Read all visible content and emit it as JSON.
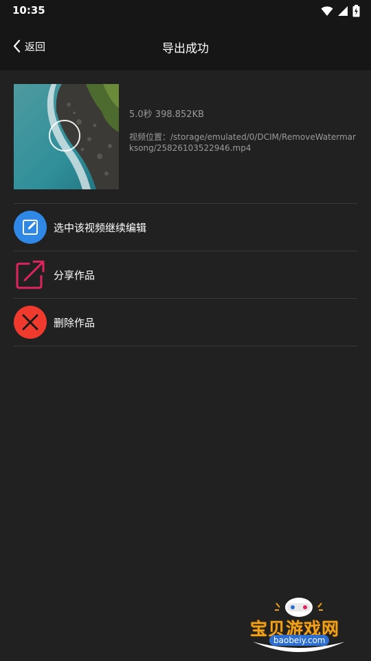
{
  "status_bar": {
    "time": "10:35"
  },
  "app_bar": {
    "back_label": "返回",
    "title": "导出成功"
  },
  "video": {
    "duration_size": "5.0秒  398.852KB",
    "location": "视频位置：/storage/emulated/0/DCIM/RemoveWatermarksong/25826103522946.mp4"
  },
  "actions": [
    {
      "label": "选中该视频继续编辑",
      "icon": "edit-icon",
      "color": "#2f87e6"
    },
    {
      "label": "分享作品",
      "icon": "share-icon",
      "color": "#e0245e"
    },
    {
      "label": "删除作品",
      "icon": "delete-icon",
      "color": "#f03a2e"
    }
  ],
  "watermark": {
    "text": "宝贝游戏网",
    "url": "baobeiy.com"
  }
}
